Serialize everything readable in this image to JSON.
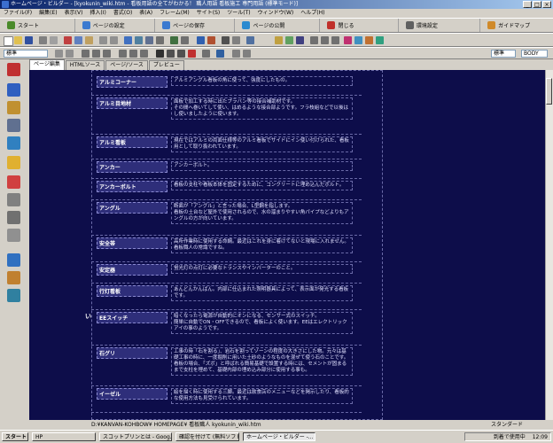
{
  "window": {
    "title": "ホームページ・ビルダー - [kyokunin_wiki.htm - 看板用語の全てがわかる！ 職人用語 看板施工 専門用語 (標準モード)]"
  },
  "menu": [
    "ファイル(F)",
    "編集(E)",
    "表示(V)",
    "挿入(I)",
    "書式(O)",
    "表(A)",
    "フレーム(M)",
    "サイト(S)",
    "ツール(T)",
    "ウィンドウ(W)",
    "ヘルプ(H)"
  ],
  "bigtoolbar": [
    {
      "label": "スタート",
      "color": "#4a8a2a"
    },
    {
      "label": "ページの設定",
      "color": "#3b7ad0"
    },
    {
      "label": "ページの保存",
      "color": "#3b7ad0"
    },
    {
      "label": "ページの公開",
      "color": "#2a8ad0"
    },
    {
      "label": "閉じる",
      "color": "#c0302a"
    },
    {
      "label": "環境設定",
      "color": "#606060"
    },
    {
      "label": "ガイドマップ",
      "color": "#d08a2a"
    }
  ],
  "format": {
    "style_value": "標準",
    "right_select_1": "標準",
    "right_select_2": "BODY"
  },
  "tabs": [
    "ページ編集",
    "HTMLソース",
    "ページ/ソース",
    "プレビュー"
  ],
  "glossary": [
    {
      "term": "アルミコーナー",
      "definition": "アルミアングル看板の角に使って、強度にしたもの。"
    },
    {
      "term": "アルミ目地材",
      "definition": "面板で加工する時に出たプラバン等の接合補助材です。\nその間へ巻いてして使い、はめるような接合部ようです。フラ枝組などで以後はし使いましたように使います。"
    },
    {
      "term": "アルミ看板",
      "definition": "現在ではアルミの両面仕様等のアルミ看板でサイドにイン使い付けられた、看板用として取り扱われています。"
    },
    {
      "term": "アンカー",
      "definition": "アンカーボルト。"
    },
    {
      "term": "アンカーボルト",
      "definition": "看板の支柱や看板本体を固定するために、コンクリートに埋め込んだボルト。"
    },
    {
      "term": "アングル",
      "definition": "断面が「アングル」と言った場合、L型鋼を指します。\n看板の土台など屋外で使用されるので、水の溜まりやすい角パイプなどよりもアングルの方が向いています。"
    },
    {
      "term": "安全帯",
      "definition": "高所作業時に使用する命綱。最近はこれを身に着けてないと現場に入れません。\n看板職人の常識ですね。"
    },
    {
      "term": "安定器",
      "definition": "蛍光灯の点灯に必要なトランスやインバーターのこと。"
    },
    {
      "term": "行灯看板",
      "definition": "あんどんかんばん。内部に仕込まれた照明器具によって、表示面が発光する看板です。"
    },
    {
      "term": "EEスイッチ",
      "definition": "暗くなったら電源が自動的にオンになる、センサー式のスイッチ。\n簡単に自動でON・OFFできるので、看板によく使います。EEはエレクトリックアイの事のようです。"
    },
    {
      "term": "石グリ",
      "definition": "工事の時「石を割る」、岩石を割ってゾーンの程度の大きさにした物。元々は基礎工事の時に、一度掘削に用いた土砂のようなものを混ぜて使う石のことです。\n看板の場合、「ズボ」と呼ばれる簡易基礎で設置する時には、セメントが固まるまで支柱を埋めて、基礎内部の埋め込み部分に使用する事も。"
    },
    {
      "term": "イーゼル",
      "definition": "絵を描く時に使用する三脚。最近は飲食店のメニューなどを掲示したり、看板的な使用方法も見受けられています。"
    }
  ],
  "section_letter": "い",
  "status": {
    "path": "D:¥KANVAN-KOHBOW¥ HOMEPAGE¥ 看板職人 kyokunin_wiki.htm",
    "mode": "スタンダード"
  },
  "taskbar": {
    "start": "スタート",
    "tasks": [
      "HP",
      "スコットプリンとは - Goog...",
      "確認を付けて (無料ソフト...",
      "ホームページ・ビルダー -..."
    ],
    "tray_text": "到着で使用中",
    "clock": "12:09"
  }
}
